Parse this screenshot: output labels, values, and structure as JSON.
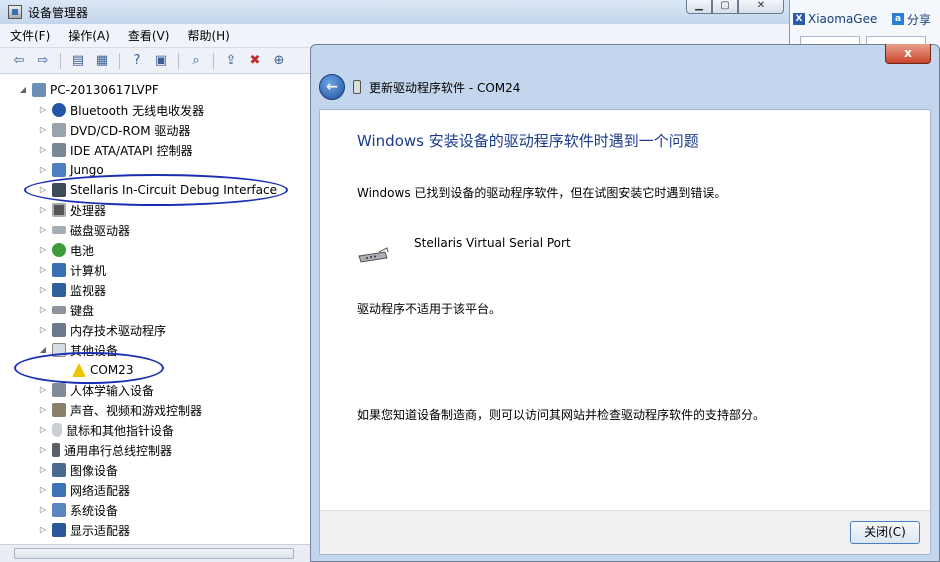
{
  "window": {
    "title": "设备管理器"
  },
  "menu": [
    "文件(F)",
    "操作(A)",
    "查看(V)",
    "帮助(H)"
  ],
  "browser": {
    "link1": "XiaomaGee",
    "link2": "分享"
  },
  "tree": {
    "root": "PC-20130617LVPF",
    "items": [
      "Bluetooth 无线电收发器",
      "DVD/CD-ROM 驱动器",
      "IDE ATA/ATAPI 控制器",
      "Jungo",
      "Stellaris In-Circuit Debug Interface",
      "处理器",
      "磁盘驱动器",
      "电池",
      "计算机",
      "监视器",
      "键盘",
      "内存技术驱动程序",
      "其他设备",
      "COM23",
      "人体学输入设备",
      "声音、视频和游戏控制器",
      "鼠标和其他指针设备",
      "通用串行总线控制器",
      "图像设备",
      "网络适配器",
      "系统设备",
      "显示适配器"
    ]
  },
  "dialog": {
    "close_glyph": "x",
    "title": "更新驱动程序软件 - COM24",
    "heading": "Windows 安装设备的驱动程序软件时遇到一个问题",
    "found_text": "Windows 已找到设备的驱动程序软件，但在试图安装它时遇到错误。",
    "device_name": "Stellaris Virtual Serial Port",
    "error_text": "驱动程序不适用于该平台。",
    "hint_text": "如果您知道设备制造商，则可以访问其网站并检查驱动程序软件的支持部分。",
    "close_button": "关闭(C)"
  }
}
